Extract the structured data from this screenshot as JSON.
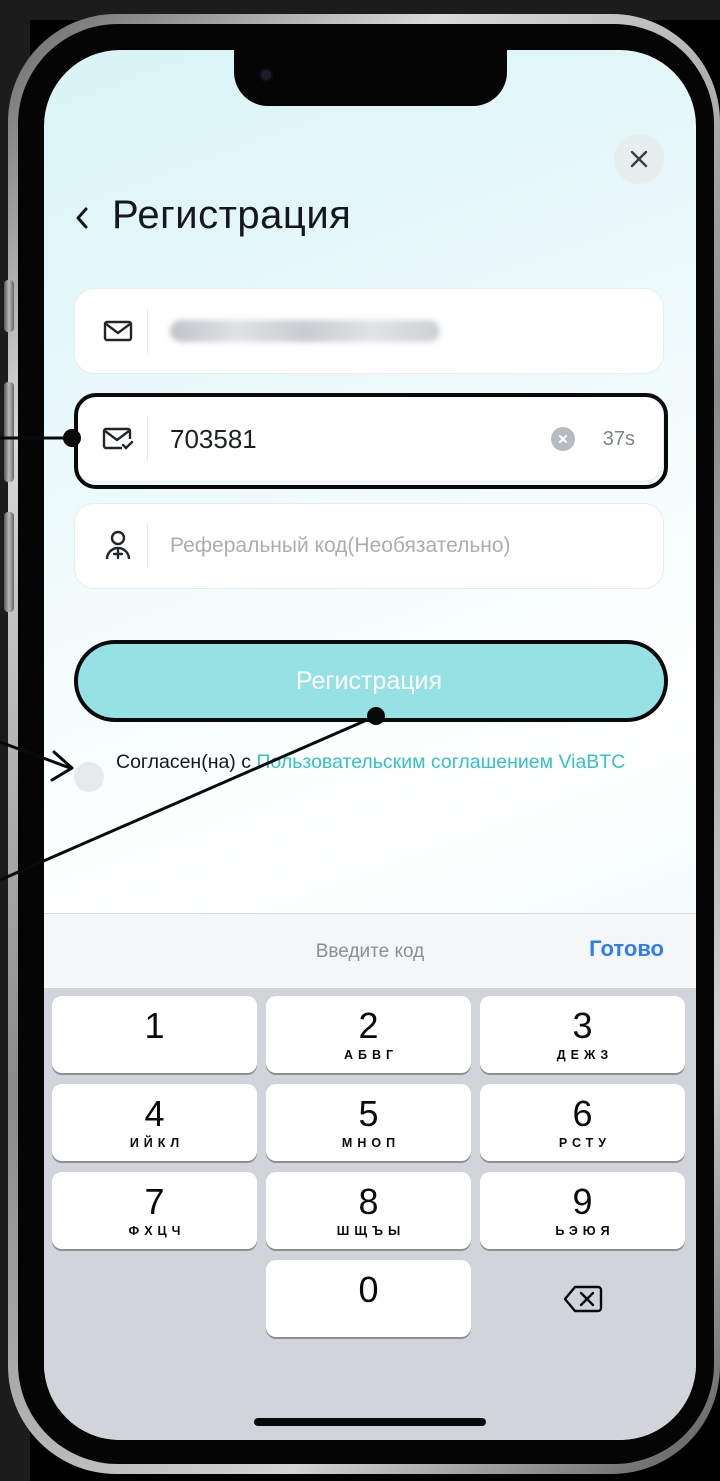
{
  "screen": {
    "title": "Регистрация",
    "close_icon": "close-icon",
    "back_icon": "chevron-left-icon"
  },
  "form": {
    "email_value_blurred": "wokoffskiy@gmail.com",
    "code_value": "703581",
    "code_timer": "37s",
    "referral_placeholder": "Реферальный код(Необязательно)",
    "submit_label": "Регистрация",
    "agreement_text": "Согласен(на) с ",
    "agreement_link": "Пользовательским соглашением ViaBTC"
  },
  "keyboard": {
    "hint": "Введите код",
    "done_label": "Готово",
    "keys": [
      {
        "digit": "1",
        "letters": ""
      },
      {
        "digit": "2",
        "letters": "АБВГ"
      },
      {
        "digit": "3",
        "letters": "ДЕЖЗ"
      },
      {
        "digit": "4",
        "letters": "ИЙКЛ"
      },
      {
        "digit": "5",
        "letters": "МНОП"
      },
      {
        "digit": "6",
        "letters": "РСТУ"
      },
      {
        "digit": "7",
        "letters": "ФХЦЧ"
      },
      {
        "digit": "8",
        "letters": "ШЩЪЫ"
      },
      {
        "digit": "9",
        "letters": "ЬЭЮЯ"
      },
      {
        "digit": "0",
        "letters": ""
      }
    ]
  },
  "colors": {
    "accent": "#33c2c8",
    "button": "#96e1e4",
    "done": "#2f7df6"
  }
}
